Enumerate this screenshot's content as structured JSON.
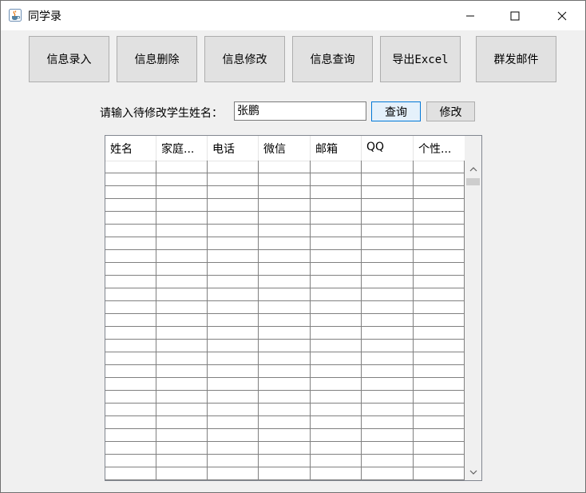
{
  "window": {
    "title": "同学录",
    "icon": "java-cup-icon"
  },
  "toolbar": {
    "buttons": [
      {
        "label": "信息录入"
      },
      {
        "label": "信息删除"
      },
      {
        "label": "信息修改"
      },
      {
        "label": "信息查询"
      },
      {
        "label": "导出Excel"
      },
      {
        "label": "群发邮件"
      }
    ]
  },
  "search": {
    "label": "请输入待修改学生姓名：",
    "value": "张鹏",
    "query_label": "查询",
    "modify_label": "修改"
  },
  "table": {
    "columns": [
      "姓名",
      "家庭...",
      "电话",
      "微信",
      "邮箱",
      "QQ",
      "个性..."
    ]
  },
  "colors": {
    "window_bg": "#f0f0f0",
    "button_bg": "#e1e1e1",
    "focus_border": "#0078d7"
  }
}
